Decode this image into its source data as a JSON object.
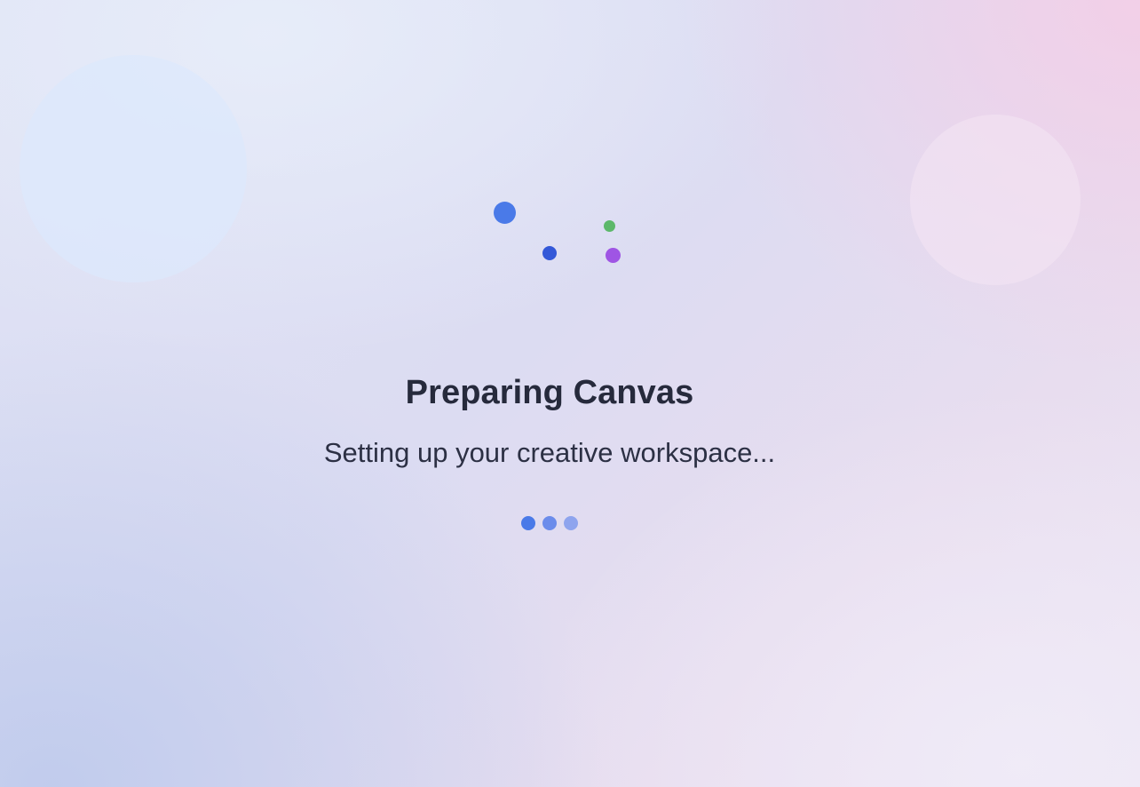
{
  "loading_screen": {
    "title": "Preparing Canvas",
    "subtitle": "Setting up your creative workspace...",
    "spinner_colors": [
      "#4a7ae8",
      "#3358d8",
      "#5cb86a",
      "#9f55e4"
    ],
    "progress_dot_colors": [
      "#4a7ae8",
      "#6b8ceb",
      "#8ea4ee"
    ]
  }
}
